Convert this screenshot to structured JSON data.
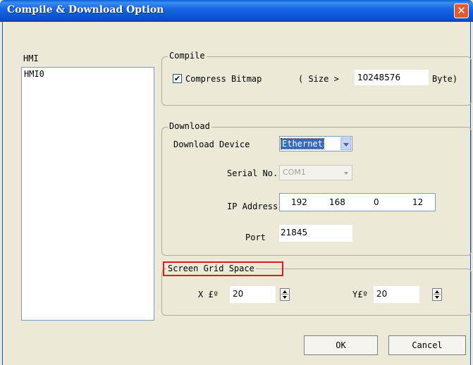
{
  "window": {
    "title": "Compile & Download Option",
    "close_glyph": "✕"
  },
  "hmi": {
    "label": "HMI",
    "items": [
      "HMI0"
    ]
  },
  "compile": {
    "legend": "Compile",
    "compress_label": "Compress Bitmap",
    "checked_glyph": "✔",
    "size_prefix": "( Size >",
    "size_value": "10248576",
    "size_unit": "Byte)"
  },
  "download": {
    "legend": "Download",
    "device_label": "Download Device",
    "device_value": "Ethernet",
    "serial_label": "Serial No.",
    "serial_value": "COM1",
    "ip_label": "IP Address",
    "ip_parts": [
      "192",
      "168",
      "0",
      "12"
    ],
    "port_label": "Port",
    "port_value": "21845"
  },
  "grid": {
    "legend": "Screen Grid Space",
    "x_label": "X £º",
    "x_value": "20",
    "y_label": "Y£º",
    "y_value": "20"
  },
  "buttons": {
    "ok": "OK",
    "cancel": "Cancel"
  },
  "colors": {
    "highlight": "#e0191e",
    "title_bar": "#0a53d3",
    "face": "#ece9d8"
  }
}
